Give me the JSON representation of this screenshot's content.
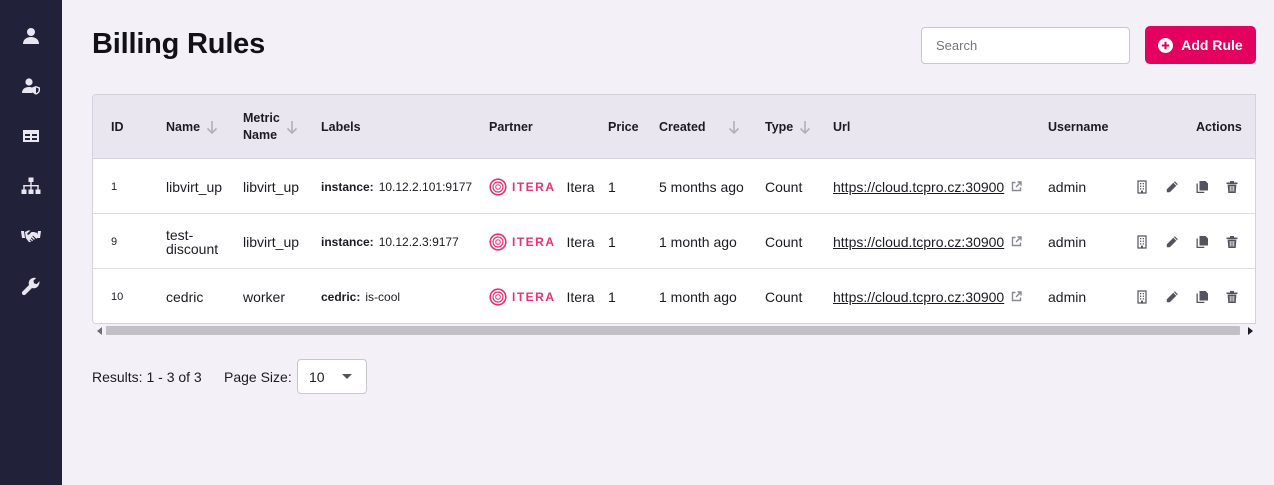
{
  "page": {
    "title": "Billing Rules"
  },
  "sidebar": {
    "items": [
      {
        "icon": "user-icon"
      },
      {
        "icon": "user-shield-icon"
      },
      {
        "icon": "table-icon"
      },
      {
        "icon": "sitemap-icon"
      },
      {
        "icon": "handshake-icon"
      },
      {
        "icon": "wrench-icon"
      }
    ]
  },
  "toolbar": {
    "search_placeholder": "Search",
    "add_label": "Add Rule",
    "add_color": "#e3005f"
  },
  "table": {
    "columns": {
      "id": "ID",
      "name": "Name",
      "metric_l1": "Metric",
      "metric_l2": "Name",
      "labels": "Labels",
      "partner": "Partner",
      "price": "Price",
      "created": "Created",
      "type": "Type",
      "url": "Url",
      "username": "Username",
      "actions": "Actions"
    },
    "rows": [
      {
        "id": "1",
        "name_l1": "libvirt_up",
        "name_l2": "",
        "metric": "libvirt_up",
        "label_key": "instance:",
        "label_val": "10.12.2.101:9177",
        "partner_logo": "ITERA",
        "partner": "Itera",
        "price": "1",
        "created": "5 months ago",
        "type": "Count",
        "url": "https://cloud.tcpro.cz:30900",
        "username": "admin"
      },
      {
        "id": "9",
        "name_l1": "test-",
        "name_l2": "discount",
        "metric": "libvirt_up",
        "label_key": "instance:",
        "label_val": "10.12.2.3:9177",
        "partner_logo": "ITERA",
        "partner": "Itera",
        "price": "1",
        "created": "1 month ago",
        "type": "Count",
        "url": "https://cloud.tcpro.cz:30900",
        "username": "admin"
      },
      {
        "id": "10",
        "name_l1": "cedric",
        "name_l2": "",
        "metric": "worker",
        "label_key": "cedric:",
        "label_val": "is-cool",
        "partner_logo": "ITERA",
        "partner": "Itera",
        "price": "1",
        "created": "1 month ago",
        "type": "Count",
        "url": "https://cloud.tcpro.cz:30900",
        "username": "admin"
      }
    ],
    "row_actions": [
      "building-icon",
      "pencil-icon",
      "copy-icon",
      "trash-icon"
    ]
  },
  "footer": {
    "results": "Results: 1 - 3 of 3",
    "page_size_label": "Page Size:",
    "page_size_value": "10"
  }
}
